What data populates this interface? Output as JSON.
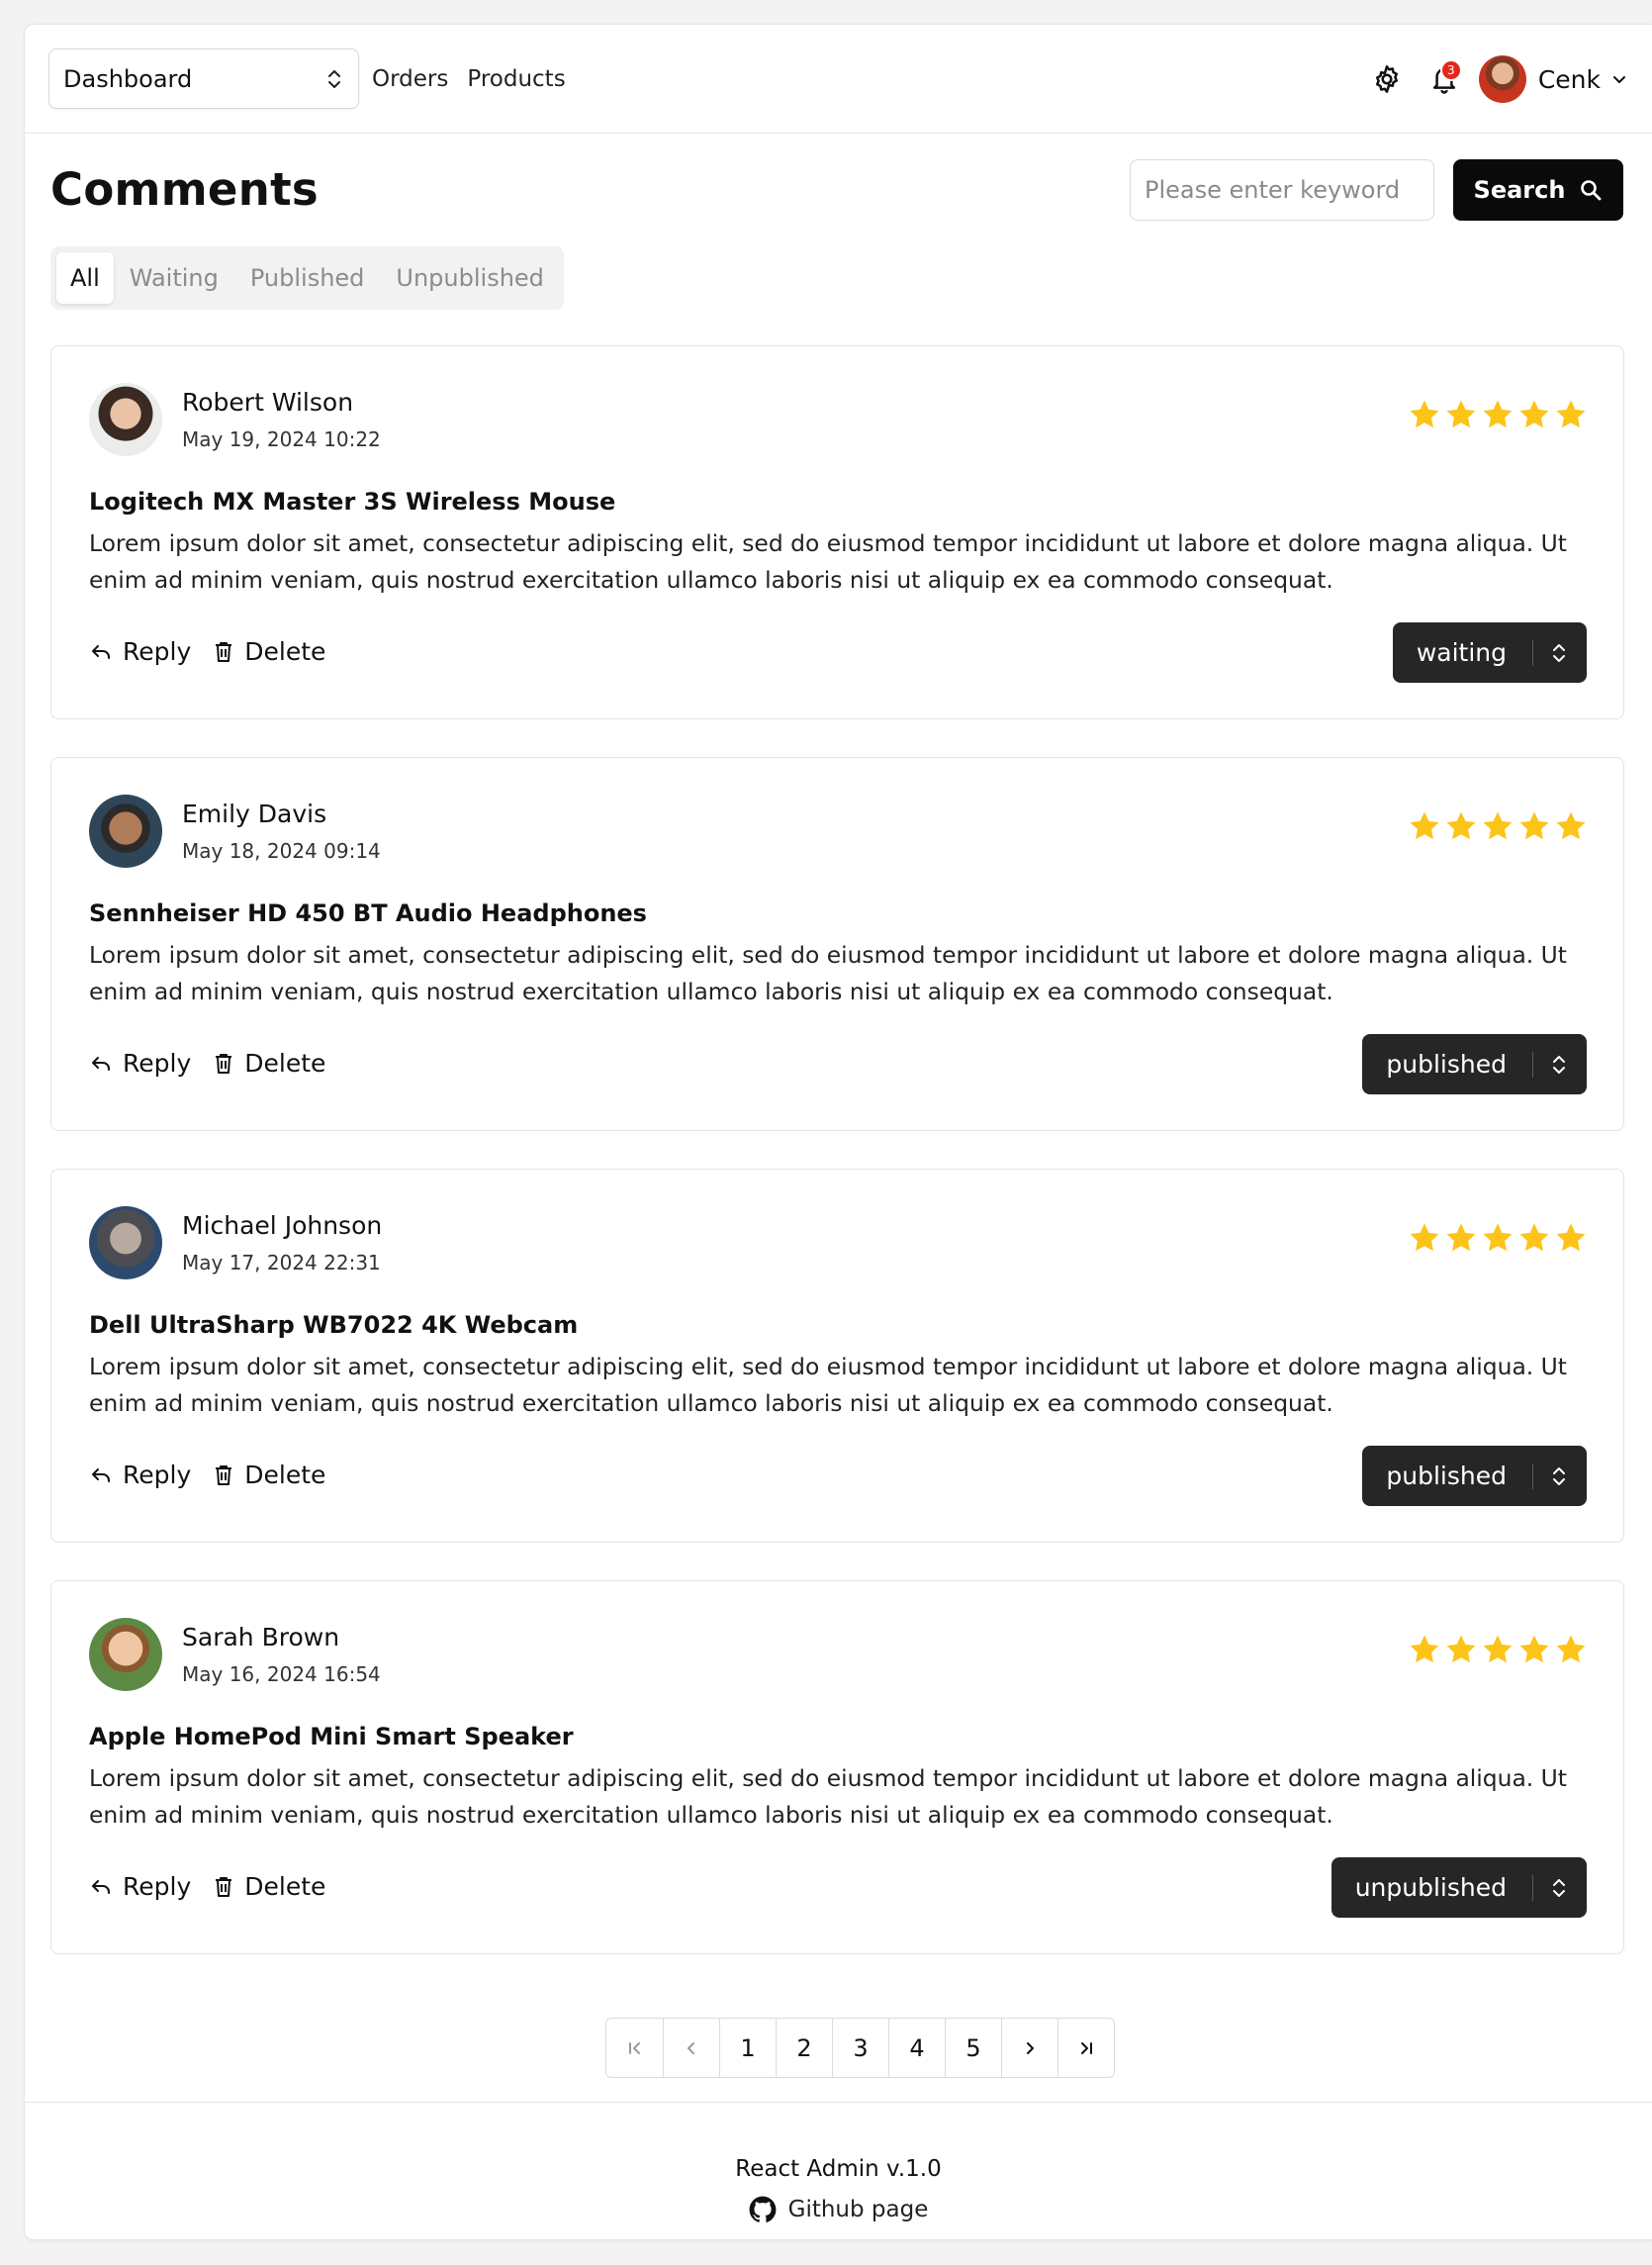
{
  "header": {
    "nav_select": "Dashboard",
    "links": [
      "Orders",
      "Products"
    ],
    "notification_count": "3",
    "user_name": "Cenk"
  },
  "page_title": "Comments",
  "search": {
    "placeholder": "Please enter keyword",
    "value": "",
    "button_label": "Search"
  },
  "tabs": [
    {
      "label": "All",
      "active": true
    },
    {
      "label": "Waiting",
      "active": false
    },
    {
      "label": "Published",
      "active": false
    },
    {
      "label": "Unpublished",
      "active": false
    }
  ],
  "comments": [
    {
      "author": "Robert Wilson",
      "date": "May 19, 2024 10:22",
      "rating": 5,
      "product": "Logitech MX Master 3S Wireless Mouse",
      "text": "Lorem ipsum dolor sit amet, consectetur adipiscing elit, sed do eiusmod tempor incididunt ut labore et dolore magna aliqua. Ut enim ad minim veniam, quis nostrud exercitation ullamco laboris nisi ut aliquip ex ea commodo consequat.",
      "reply_label": "Reply",
      "delete_label": "Delete",
      "status": "waiting"
    },
    {
      "author": "Emily Davis",
      "date": "May 18, 2024 09:14",
      "rating": 5,
      "product": "Sennheiser HD 450 BT Audio Headphones",
      "text": "Lorem ipsum dolor sit amet, consectetur adipiscing elit, sed do eiusmod tempor incididunt ut labore et dolore magna aliqua. Ut enim ad minim veniam, quis nostrud exercitation ullamco laboris nisi ut aliquip ex ea commodo consequat.",
      "reply_label": "Reply",
      "delete_label": "Delete",
      "status": "published"
    },
    {
      "author": "Michael Johnson",
      "date": "May 17, 2024 22:31",
      "rating": 5,
      "product": "Dell UltraSharp WB7022 4K Webcam",
      "text": "Lorem ipsum dolor sit amet, consectetur adipiscing elit, sed do eiusmod tempor incididunt ut labore et dolore magna aliqua. Ut enim ad minim veniam, quis nostrud exercitation ullamco laboris nisi ut aliquip ex ea commodo consequat.",
      "reply_label": "Reply",
      "delete_label": "Delete",
      "status": "published"
    },
    {
      "author": "Sarah Brown",
      "date": "May 16, 2024 16:54",
      "rating": 5,
      "product": "Apple HomePod Mini Smart Speaker",
      "text": "Lorem ipsum dolor sit amet, consectetur adipiscing elit, sed do eiusmod tempor incididunt ut labore et dolore magna aliqua. Ut enim ad minim veniam, quis nostrud exercitation ullamco laboris nisi ut aliquip ex ea commodo consequat.",
      "reply_label": "Reply",
      "delete_label": "Delete",
      "status": "unpublished"
    }
  ],
  "pagination": {
    "pages": [
      "1",
      "2",
      "3",
      "4",
      "5"
    ],
    "current": "1"
  },
  "footer": {
    "title": "React Admin v.1.0",
    "link_label": "Github page"
  },
  "colors": {
    "star": "#fcc419",
    "status_bg": "#262626",
    "badge": "#e5251b",
    "primary": "#0a0a0a"
  }
}
